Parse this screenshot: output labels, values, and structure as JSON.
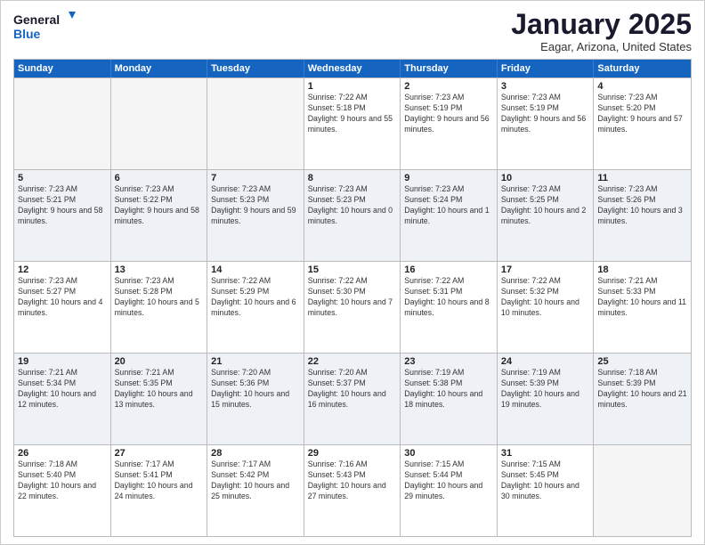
{
  "logo": {
    "line1": "General",
    "line2": "Blue"
  },
  "header": {
    "month": "January 2025",
    "location": "Eagar, Arizona, United States"
  },
  "days_of_week": [
    "Sunday",
    "Monday",
    "Tuesday",
    "Wednesday",
    "Thursday",
    "Friday",
    "Saturday"
  ],
  "rows": [
    {
      "alt": false,
      "cells": [
        {
          "day": "",
          "sunrise": "",
          "sunset": "",
          "daylight": "",
          "empty": true
        },
        {
          "day": "",
          "sunrise": "",
          "sunset": "",
          "daylight": "",
          "empty": true
        },
        {
          "day": "",
          "sunrise": "",
          "sunset": "",
          "daylight": "",
          "empty": true
        },
        {
          "day": "1",
          "sunrise": "Sunrise: 7:22 AM",
          "sunset": "Sunset: 5:18 PM",
          "daylight": "Daylight: 9 hours and 55 minutes.",
          "empty": false
        },
        {
          "day": "2",
          "sunrise": "Sunrise: 7:23 AM",
          "sunset": "Sunset: 5:19 PM",
          "daylight": "Daylight: 9 hours and 56 minutes.",
          "empty": false
        },
        {
          "day": "3",
          "sunrise": "Sunrise: 7:23 AM",
          "sunset": "Sunset: 5:19 PM",
          "daylight": "Daylight: 9 hours and 56 minutes.",
          "empty": false
        },
        {
          "day": "4",
          "sunrise": "Sunrise: 7:23 AM",
          "sunset": "Sunset: 5:20 PM",
          "daylight": "Daylight: 9 hours and 57 minutes.",
          "empty": false
        }
      ]
    },
    {
      "alt": true,
      "cells": [
        {
          "day": "5",
          "sunrise": "Sunrise: 7:23 AM",
          "sunset": "Sunset: 5:21 PM",
          "daylight": "Daylight: 9 hours and 58 minutes.",
          "empty": false
        },
        {
          "day": "6",
          "sunrise": "Sunrise: 7:23 AM",
          "sunset": "Sunset: 5:22 PM",
          "daylight": "Daylight: 9 hours and 58 minutes.",
          "empty": false
        },
        {
          "day": "7",
          "sunrise": "Sunrise: 7:23 AM",
          "sunset": "Sunset: 5:23 PM",
          "daylight": "Daylight: 9 hours and 59 minutes.",
          "empty": false
        },
        {
          "day": "8",
          "sunrise": "Sunrise: 7:23 AM",
          "sunset": "Sunset: 5:23 PM",
          "daylight": "Daylight: 10 hours and 0 minutes.",
          "empty": false
        },
        {
          "day": "9",
          "sunrise": "Sunrise: 7:23 AM",
          "sunset": "Sunset: 5:24 PM",
          "daylight": "Daylight: 10 hours and 1 minute.",
          "empty": false
        },
        {
          "day": "10",
          "sunrise": "Sunrise: 7:23 AM",
          "sunset": "Sunset: 5:25 PM",
          "daylight": "Daylight: 10 hours and 2 minutes.",
          "empty": false
        },
        {
          "day": "11",
          "sunrise": "Sunrise: 7:23 AM",
          "sunset": "Sunset: 5:26 PM",
          "daylight": "Daylight: 10 hours and 3 minutes.",
          "empty": false
        }
      ]
    },
    {
      "alt": false,
      "cells": [
        {
          "day": "12",
          "sunrise": "Sunrise: 7:23 AM",
          "sunset": "Sunset: 5:27 PM",
          "daylight": "Daylight: 10 hours and 4 minutes.",
          "empty": false
        },
        {
          "day": "13",
          "sunrise": "Sunrise: 7:23 AM",
          "sunset": "Sunset: 5:28 PM",
          "daylight": "Daylight: 10 hours and 5 minutes.",
          "empty": false
        },
        {
          "day": "14",
          "sunrise": "Sunrise: 7:22 AM",
          "sunset": "Sunset: 5:29 PM",
          "daylight": "Daylight: 10 hours and 6 minutes.",
          "empty": false
        },
        {
          "day": "15",
          "sunrise": "Sunrise: 7:22 AM",
          "sunset": "Sunset: 5:30 PM",
          "daylight": "Daylight: 10 hours and 7 minutes.",
          "empty": false
        },
        {
          "day": "16",
          "sunrise": "Sunrise: 7:22 AM",
          "sunset": "Sunset: 5:31 PM",
          "daylight": "Daylight: 10 hours and 8 minutes.",
          "empty": false
        },
        {
          "day": "17",
          "sunrise": "Sunrise: 7:22 AM",
          "sunset": "Sunset: 5:32 PM",
          "daylight": "Daylight: 10 hours and 10 minutes.",
          "empty": false
        },
        {
          "day": "18",
          "sunrise": "Sunrise: 7:21 AM",
          "sunset": "Sunset: 5:33 PM",
          "daylight": "Daylight: 10 hours and 11 minutes.",
          "empty": false
        }
      ]
    },
    {
      "alt": true,
      "cells": [
        {
          "day": "19",
          "sunrise": "Sunrise: 7:21 AM",
          "sunset": "Sunset: 5:34 PM",
          "daylight": "Daylight: 10 hours and 12 minutes.",
          "empty": false
        },
        {
          "day": "20",
          "sunrise": "Sunrise: 7:21 AM",
          "sunset": "Sunset: 5:35 PM",
          "daylight": "Daylight: 10 hours and 13 minutes.",
          "empty": false
        },
        {
          "day": "21",
          "sunrise": "Sunrise: 7:20 AM",
          "sunset": "Sunset: 5:36 PM",
          "daylight": "Daylight: 10 hours and 15 minutes.",
          "empty": false
        },
        {
          "day": "22",
          "sunrise": "Sunrise: 7:20 AM",
          "sunset": "Sunset: 5:37 PM",
          "daylight": "Daylight: 10 hours and 16 minutes.",
          "empty": false
        },
        {
          "day": "23",
          "sunrise": "Sunrise: 7:19 AM",
          "sunset": "Sunset: 5:38 PM",
          "daylight": "Daylight: 10 hours and 18 minutes.",
          "empty": false
        },
        {
          "day": "24",
          "sunrise": "Sunrise: 7:19 AM",
          "sunset": "Sunset: 5:39 PM",
          "daylight": "Daylight: 10 hours and 19 minutes.",
          "empty": false
        },
        {
          "day": "25",
          "sunrise": "Sunrise: 7:18 AM",
          "sunset": "Sunset: 5:39 PM",
          "daylight": "Daylight: 10 hours and 21 minutes.",
          "empty": false
        }
      ]
    },
    {
      "alt": false,
      "cells": [
        {
          "day": "26",
          "sunrise": "Sunrise: 7:18 AM",
          "sunset": "Sunset: 5:40 PM",
          "daylight": "Daylight: 10 hours and 22 minutes.",
          "empty": false
        },
        {
          "day": "27",
          "sunrise": "Sunrise: 7:17 AM",
          "sunset": "Sunset: 5:41 PM",
          "daylight": "Daylight: 10 hours and 24 minutes.",
          "empty": false
        },
        {
          "day": "28",
          "sunrise": "Sunrise: 7:17 AM",
          "sunset": "Sunset: 5:42 PM",
          "daylight": "Daylight: 10 hours and 25 minutes.",
          "empty": false
        },
        {
          "day": "29",
          "sunrise": "Sunrise: 7:16 AM",
          "sunset": "Sunset: 5:43 PM",
          "daylight": "Daylight: 10 hours and 27 minutes.",
          "empty": false
        },
        {
          "day": "30",
          "sunrise": "Sunrise: 7:15 AM",
          "sunset": "Sunset: 5:44 PM",
          "daylight": "Daylight: 10 hours and 29 minutes.",
          "empty": false
        },
        {
          "day": "31",
          "sunrise": "Sunrise: 7:15 AM",
          "sunset": "Sunset: 5:45 PM",
          "daylight": "Daylight: 10 hours and 30 minutes.",
          "empty": false
        },
        {
          "day": "",
          "sunrise": "",
          "sunset": "",
          "daylight": "",
          "empty": true
        }
      ]
    }
  ]
}
